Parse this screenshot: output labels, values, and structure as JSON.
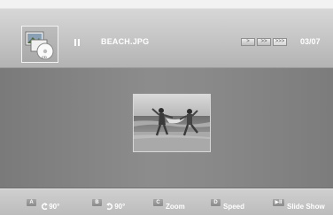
{
  "header": {
    "filename": "BEACH.JPG",
    "counter": "03/07",
    "playback_state_icon": "pause-icon",
    "speed_buttons": [
      ">",
      ">>",
      ">>>"
    ],
    "media_icon": "photo-media-icon"
  },
  "photo": {
    "description_icon": "beach-photo"
  },
  "controls": [
    {
      "key": "A",
      "icon": "rotate-left-icon",
      "label": "90°"
    },
    {
      "key": "B",
      "icon": "rotate-right-icon",
      "label": "90°"
    },
    {
      "key": "C",
      "label": "Zoom"
    },
    {
      "key": "D",
      "label": "Speed"
    },
    {
      "key": "▶II",
      "label": "Slide Show"
    }
  ]
}
